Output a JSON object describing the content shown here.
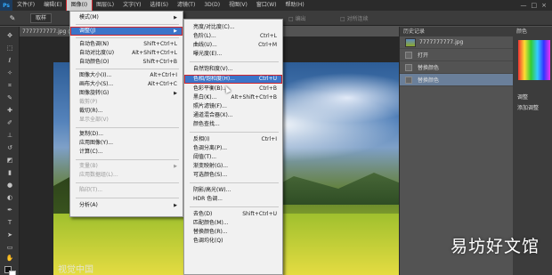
{
  "app": {
    "logo": "Ps"
  },
  "menubar": {
    "items": [
      "文件(F)",
      "编辑(E)",
      "图像(I)",
      "图层(L)",
      "文字(Y)",
      "选择(S)",
      "滤镜(T)",
      "3D(D)",
      "视图(V)",
      "窗口(W)",
      "帮助(H)"
    ],
    "active_index": 2,
    "window_controls": [
      "—",
      "□",
      "×"
    ]
  },
  "options_bar": {
    "tool_icon": "eyedropper-icon",
    "chip": "取样",
    "extra1": "□ 编出",
    "extra2": "□ 对所连续"
  },
  "document": {
    "tab": "7777777777.jpg @ 84%"
  },
  "image_menu": {
    "items": [
      {
        "label": "模式(M)",
        "shortcut": "▶",
        "state": "normal"
      },
      {
        "label": "调整(J)",
        "shortcut": "▶",
        "state": "highlighted"
      },
      {
        "label": "自动色调(N)",
        "shortcut": "Shift+Ctrl+L",
        "state": "normal"
      },
      {
        "label": "自动对比度(U)",
        "shortcut": "Alt+Shift+Ctrl+L",
        "state": "normal"
      },
      {
        "label": "自动颜色(O)",
        "shortcut": "Shift+Ctrl+B",
        "state": "normal"
      },
      {
        "label": "图像大小(I)...",
        "shortcut": "Alt+Ctrl+I",
        "state": "normal"
      },
      {
        "label": "画布大小(S)...",
        "shortcut": "Alt+Ctrl+C",
        "state": "normal"
      },
      {
        "label": "图像旋转(G)",
        "shortcut": "▶",
        "state": "normal"
      },
      {
        "label": "裁剪(P)",
        "shortcut": "",
        "state": "disabled"
      },
      {
        "label": "裁切(R)...",
        "shortcut": "",
        "state": "normal"
      },
      {
        "label": "显示全部(V)",
        "shortcut": "",
        "state": "disabled"
      },
      {
        "label": "复制(D)...",
        "shortcut": "",
        "state": "normal"
      },
      {
        "label": "应用图像(Y)...",
        "shortcut": "",
        "state": "normal"
      },
      {
        "label": "计算(C)...",
        "shortcut": "",
        "state": "normal"
      },
      {
        "label": "变量(B)",
        "shortcut": "▶",
        "state": "disabled"
      },
      {
        "label": "应用数据组(L)...",
        "shortcut": "",
        "state": "disabled"
      },
      {
        "label": "陷印(T)...",
        "shortcut": "",
        "state": "disabled"
      },
      {
        "label": "分析(A)",
        "shortcut": "▶",
        "state": "normal"
      }
    ]
  },
  "adjust_menu": {
    "items": [
      {
        "label": "亮度/对比度(C)...",
        "shortcut": ""
      },
      {
        "label": "色阶(L)...",
        "shortcut": "Ctrl+L"
      },
      {
        "label": "曲线(U)...",
        "shortcut": "Ctrl+M"
      },
      {
        "label": "曝光度(E)...",
        "shortcut": ""
      },
      {
        "label": "自然饱和度(V)...",
        "shortcut": ""
      },
      {
        "label": "色相/饱和度(H)...",
        "shortcut": "Ctrl+U"
      },
      {
        "label": "色彩平衡(B)...",
        "shortcut": "Ctrl+B"
      },
      {
        "label": "黑白(K)...",
        "shortcut": "Alt+Shift+Ctrl+B"
      },
      {
        "label": "照片滤镜(F)...",
        "shortcut": ""
      },
      {
        "label": "通道混合器(X)...",
        "shortcut": ""
      },
      {
        "label": "颜色查找...",
        "shortcut": ""
      },
      {
        "label": "反相(I)",
        "shortcut": "Ctrl+I"
      },
      {
        "label": "色调分离(P)...",
        "shortcut": ""
      },
      {
        "label": "阈值(T)...",
        "shortcut": ""
      },
      {
        "label": "渐变映射(G)...",
        "shortcut": ""
      },
      {
        "label": "可选颜色(S)...",
        "shortcut": ""
      },
      {
        "label": "阴影/高光(W)...",
        "shortcut": ""
      },
      {
        "label": "HDR 色调...",
        "shortcut": ""
      },
      {
        "label": "去色(D)",
        "shortcut": "Shift+Ctrl+U"
      },
      {
        "label": "匹配颜色(M)...",
        "shortcut": ""
      },
      {
        "label": "替换颜色(R)...",
        "shortcut": ""
      },
      {
        "label": "色调均化(Q)",
        "shortcut": ""
      }
    ],
    "highlight_index": 5
  },
  "history_panel": {
    "title": "历史记录",
    "snapshot": "7777777777.jpg",
    "states": [
      "打开",
      "替换颜色",
      "替换颜色"
    ],
    "selected_index": 2
  },
  "right_panels": {
    "color_tab": "颜色",
    "adjust_tab": "调整",
    "adjust_sub": "添加调整"
  },
  "watermarks": {
    "bottom_left": "视觉中国",
    "brand": "易坊好文馆"
  }
}
